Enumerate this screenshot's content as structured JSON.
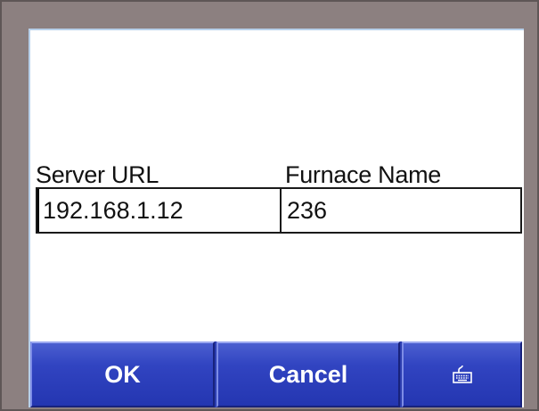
{
  "form": {
    "server_url_label": "Server URL",
    "furnace_name_label": "Furnace Name",
    "server_url_value": "192.168.1.12",
    "furnace_name_value": "236"
  },
  "buttons": {
    "ok_label": "OK",
    "cancel_label": "Cancel",
    "keyboard_icon": "keyboard-icon"
  },
  "colors": {
    "bezel": "#8c8080",
    "button_blue": "#3144c1",
    "screen_bg": "#ffffff"
  }
}
